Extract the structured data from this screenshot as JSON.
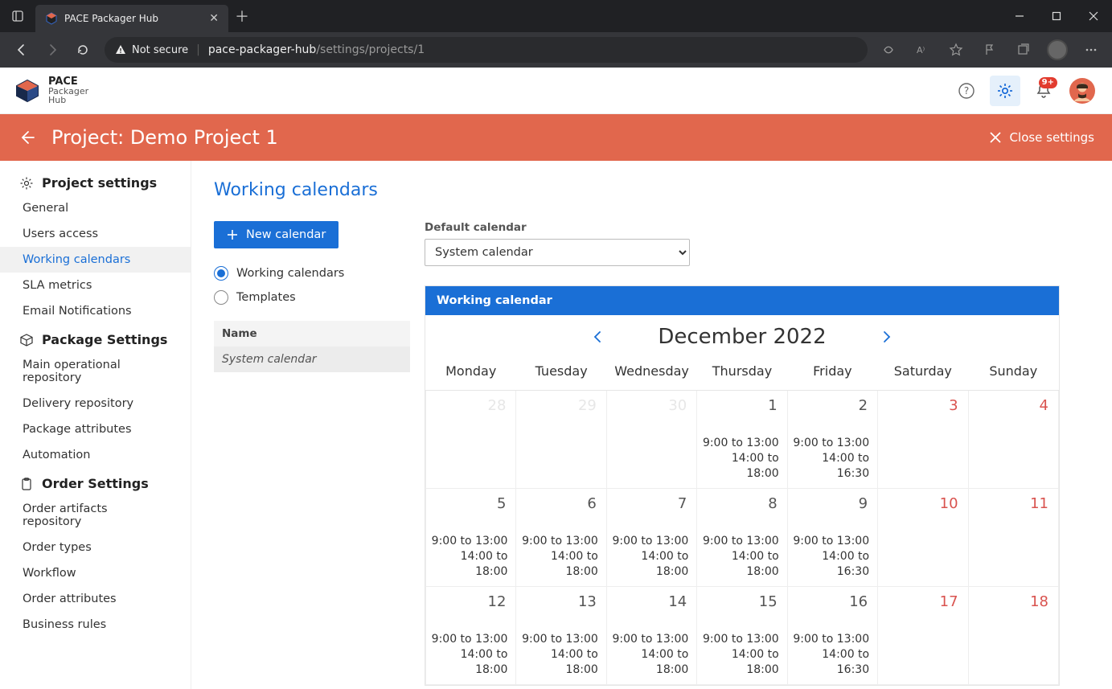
{
  "window": {
    "tab_title": "PACE Packager Hub",
    "url_security": "Not secure",
    "url_host": "pace-packager-hub",
    "url_path": "/settings/projects/1"
  },
  "brand": {
    "l1": "PACE",
    "l2": "Packager",
    "l3": "Hub"
  },
  "notif_badge": "9+",
  "projectbar": {
    "title": "Project: Demo Project 1",
    "close_label": "Close settings"
  },
  "sidebar": {
    "group1_label": "Project settings",
    "group1_items": [
      "General",
      "Users access",
      "Working calendars",
      "SLA metrics",
      "Email Notifications"
    ],
    "group1_selected": 2,
    "group2_label": "Package Settings",
    "group2_items": [
      "Main operational repository",
      "Delivery repository",
      "Package attributes",
      "Automation"
    ],
    "group3_label": "Order Settings",
    "group3_items": [
      "Order artifacts repository",
      "Order types",
      "Workflow",
      "Order attributes",
      "Business rules"
    ]
  },
  "page": {
    "title": "Working calendars",
    "new_button": "New calendar",
    "radio_working": "Working calendars",
    "radio_templates": "Templates",
    "list_header": "Name",
    "list_rows": [
      "System calendar"
    ],
    "default_label": "Default calendar",
    "default_value": "System calendar"
  },
  "calendar": {
    "title": "Working calendar",
    "month_label": "December 2022",
    "dow": [
      "Monday",
      "Tuesday",
      "Wednesday",
      "Thursday",
      "Friday",
      "Saturday",
      "Sunday"
    ],
    "weeks": [
      [
        {
          "n": "28",
          "other": true
        },
        {
          "n": "29",
          "other": true
        },
        {
          "n": "30",
          "other": true
        },
        {
          "n": "1",
          "slots": [
            "9:00 to 13:00",
            "14:00 to 18:00"
          ]
        },
        {
          "n": "2",
          "slots": [
            "9:00 to 13:00",
            "14:00 to 16:30"
          ]
        },
        {
          "n": "3",
          "wend": true
        },
        {
          "n": "4",
          "wend": true
        }
      ],
      [
        {
          "n": "5",
          "slots": [
            "9:00 to 13:00",
            "14:00 to 18:00"
          ]
        },
        {
          "n": "6",
          "slots": [
            "9:00 to 13:00",
            "14:00 to 18:00"
          ]
        },
        {
          "n": "7",
          "slots": [
            "9:00 to 13:00",
            "14:00 to 18:00"
          ]
        },
        {
          "n": "8",
          "slots": [
            "9:00 to 13:00",
            "14:00 to 18:00"
          ]
        },
        {
          "n": "9",
          "slots": [
            "9:00 to 13:00",
            "14:00 to 16:30"
          ]
        },
        {
          "n": "10",
          "wend": true
        },
        {
          "n": "11",
          "wend": true
        }
      ],
      [
        {
          "n": "12",
          "slots": [
            "9:00 to 13:00",
            "14:00 to 18:00"
          ]
        },
        {
          "n": "13",
          "slots": [
            "9:00 to 13:00",
            "14:00 to 18:00"
          ]
        },
        {
          "n": "14",
          "slots": [
            "9:00 to 13:00",
            "14:00 to 18:00"
          ]
        },
        {
          "n": "15",
          "slots": [
            "9:00 to 13:00",
            "14:00 to 18:00"
          ]
        },
        {
          "n": "16",
          "slots": [
            "9:00 to 13:00",
            "14:00 to 16:30"
          ]
        },
        {
          "n": "17",
          "wend": true
        },
        {
          "n": "18",
          "wend": true
        }
      ]
    ]
  }
}
